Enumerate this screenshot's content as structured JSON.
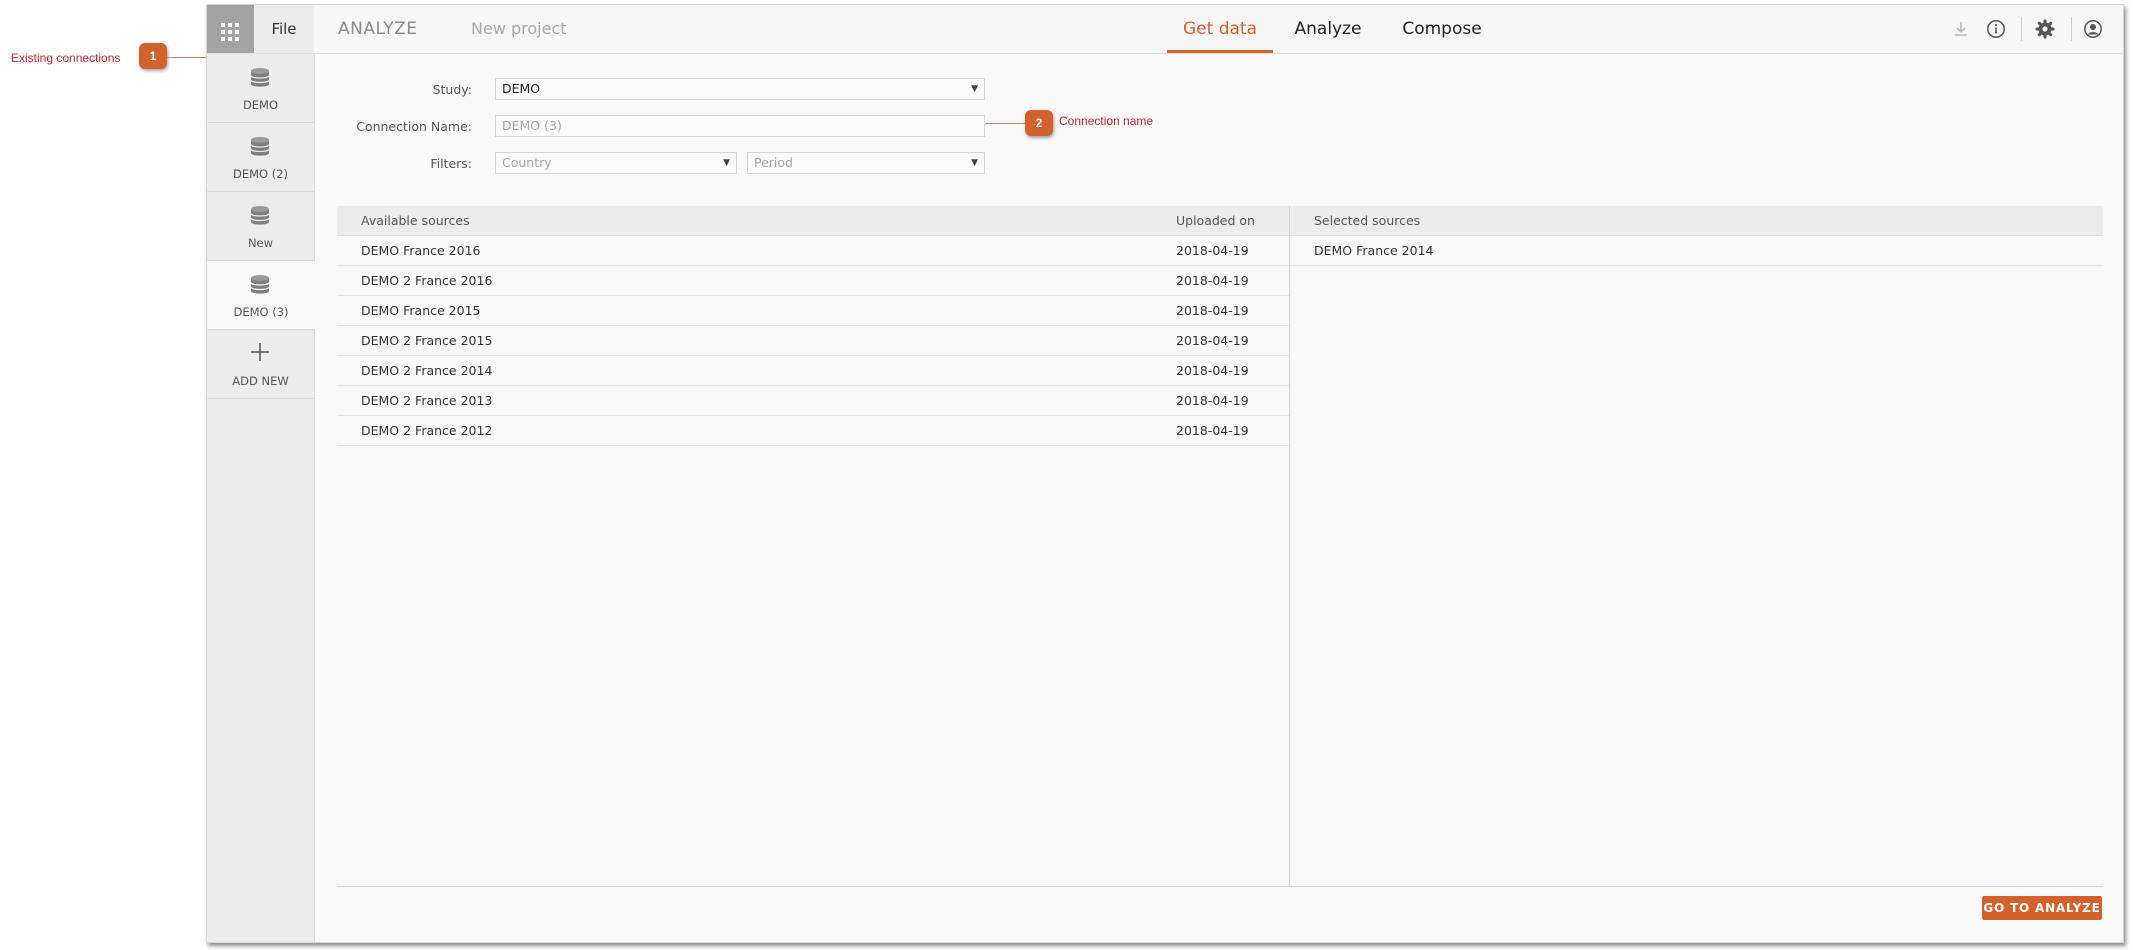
{
  "callouts": {
    "existing_connections": {
      "number": "1",
      "label": "Existing connections"
    },
    "connection_name": {
      "number": "2",
      "label": "Connection name"
    }
  },
  "topbar": {
    "file_label": "File",
    "app_name": "ANALYZE",
    "project_name": "New project",
    "tabs": [
      {
        "label": "Get data",
        "active": true
      },
      {
        "label": "Analyze",
        "active": false
      },
      {
        "label": "Compose",
        "active": false
      }
    ],
    "icons": [
      "apps-grid-icon",
      "download-icon",
      "info-icon",
      "gear-icon",
      "user-account-icon"
    ]
  },
  "sidebar": {
    "connections": [
      {
        "label": "DEMO",
        "icon": "database-icon"
      },
      {
        "label": "DEMO (2)",
        "icon": "database-icon"
      },
      {
        "label": "New",
        "icon": "database-icon"
      },
      {
        "label": "DEMO (3)",
        "icon": "database-icon",
        "active": true
      }
    ],
    "add_new_label": "ADD NEW"
  },
  "form": {
    "study_label": "Study:",
    "study_value": "DEMO",
    "connection_name_label": "Connection Name:",
    "connection_name_placeholder": "DEMO (3)",
    "filters_label": "Filters:",
    "country_placeholder": "Country",
    "period_placeholder": "Period"
  },
  "available": {
    "header_sources": "Available sources",
    "header_uploaded": "Uploaded on",
    "rows": [
      {
        "name": "DEMO France 2016",
        "date": "2018-04-19"
      },
      {
        "name": "DEMO 2 France 2016",
        "date": "2018-04-19"
      },
      {
        "name": "DEMO France 2015",
        "date": "2018-04-19"
      },
      {
        "name": "DEMO 2 France 2015",
        "date": "2018-04-19"
      },
      {
        "name": "DEMO 2 France 2014",
        "date": "2018-04-19"
      },
      {
        "name": "DEMO 2 France 2013",
        "date": "2018-04-19"
      },
      {
        "name": "DEMO 2 France 2012",
        "date": "2018-04-19"
      }
    ]
  },
  "selected": {
    "header": "Selected sources",
    "rows": [
      {
        "name": "DEMO France 2014"
      }
    ]
  },
  "actions": {
    "go_to_analyze": "GO TO ANALYZE"
  },
  "colors": {
    "accent": "#d3612d",
    "callout_text": "#c0262b"
  }
}
